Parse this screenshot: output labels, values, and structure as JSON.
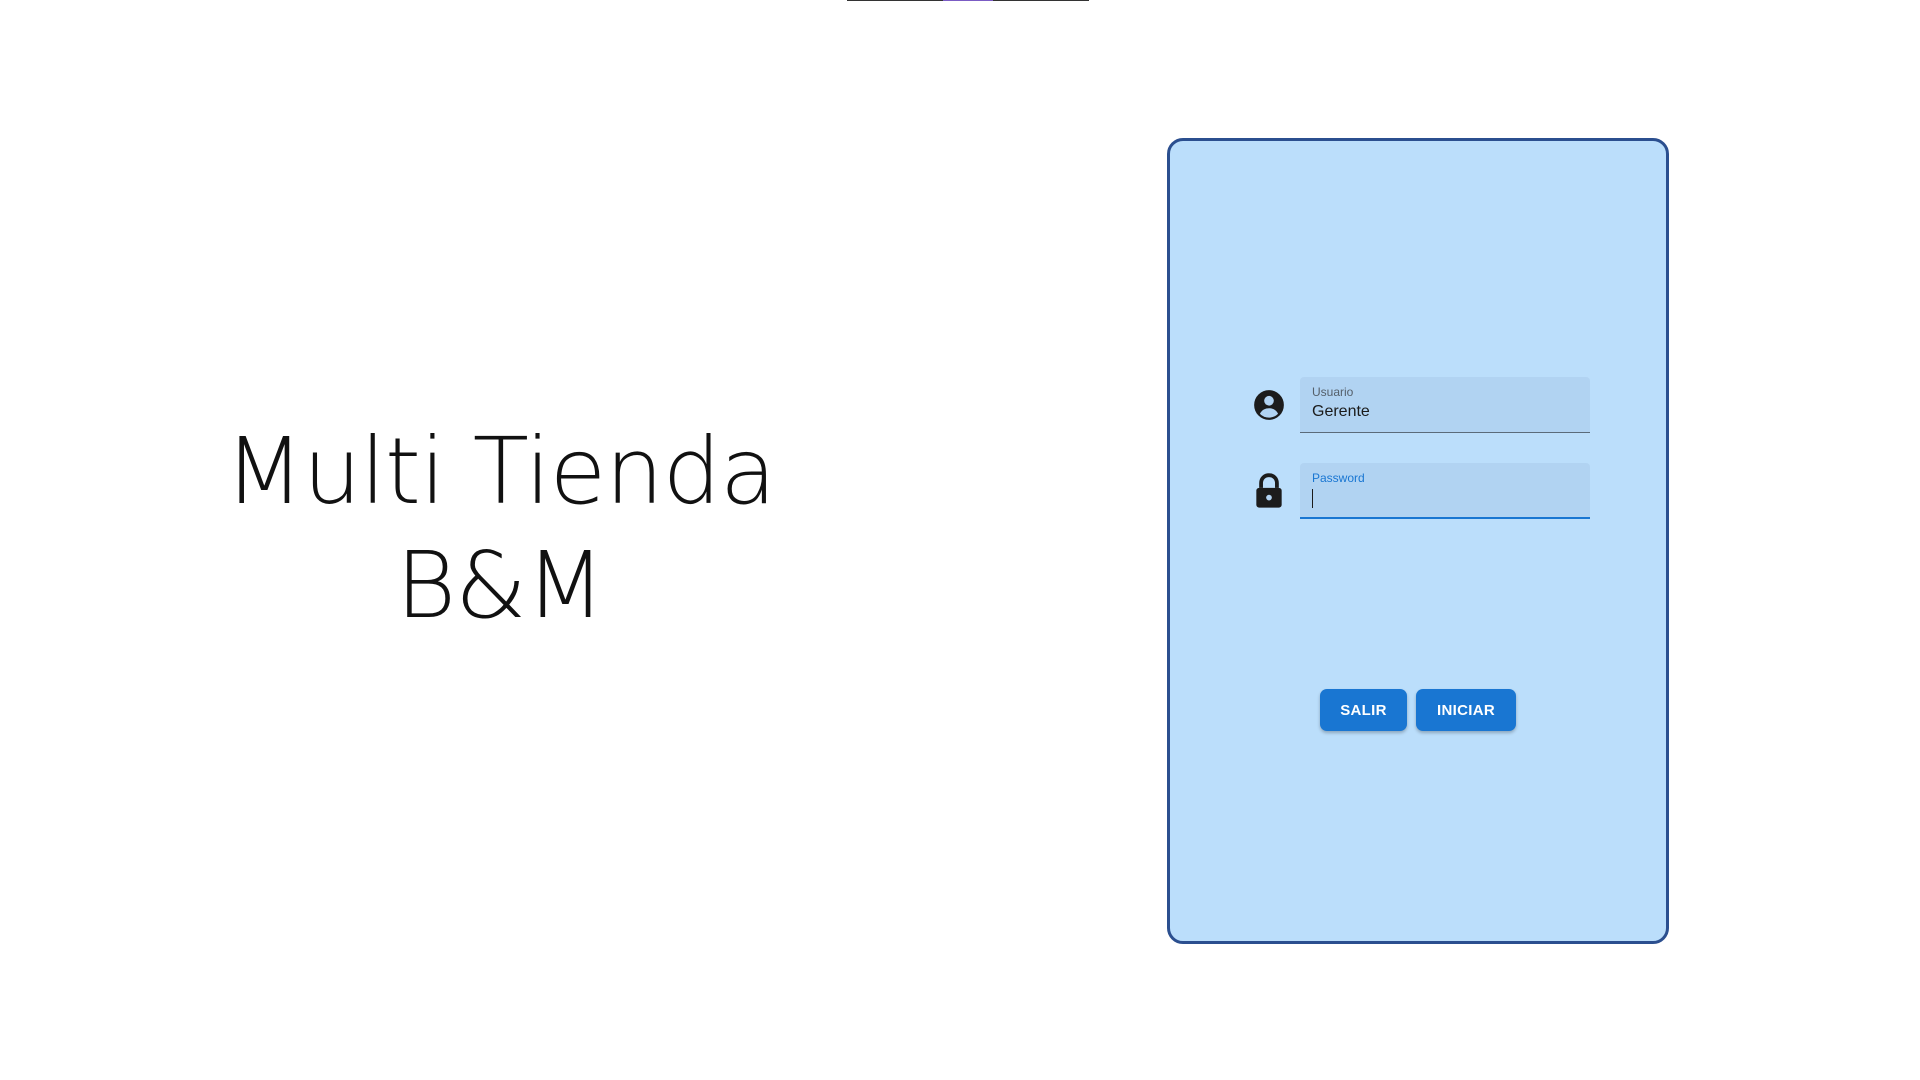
{
  "brand": {
    "line1": "Multi Tienda",
    "line2": "B&M"
  },
  "login": {
    "usuario": {
      "label": "Usuario",
      "value": "Gerente",
      "icon": "account-circle-icon"
    },
    "password": {
      "label": "Password",
      "value": "",
      "icon": "lock-icon"
    },
    "buttons": {
      "exit_label": "SALIR",
      "start_label": "INICIAR"
    }
  },
  "colors": {
    "card_background": "#bbdefb",
    "card_border": "#2b4f8f",
    "field_background": "#b1d3f2",
    "primary": "#1976d2",
    "text": "#111111"
  }
}
